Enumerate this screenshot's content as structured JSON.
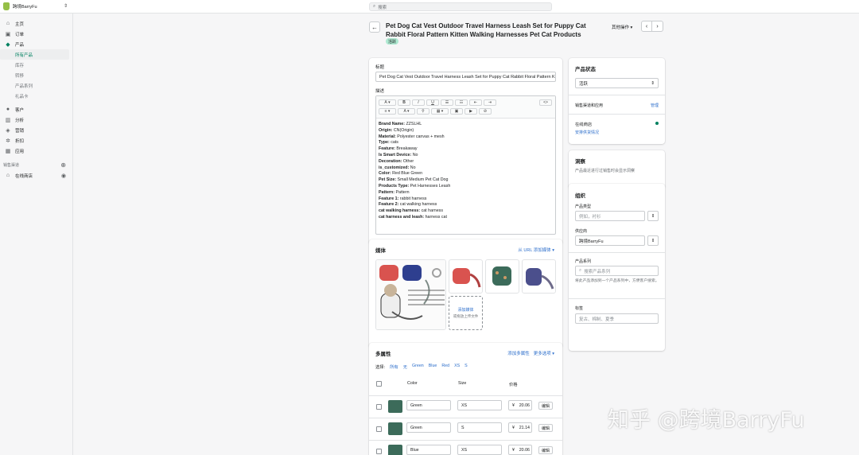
{
  "topbar": {
    "store_name": "跨境BarryFu",
    "search_placeholder": "搜索"
  },
  "sidebar": {
    "items": [
      {
        "label": "主页",
        "icon": "home-icon"
      },
      {
        "label": "订单",
        "icon": "orders-icon"
      },
      {
        "label": "产品",
        "icon": "tag-icon"
      }
    ],
    "product_subitems": [
      "所有产品",
      "库存",
      "转移",
      "产品系列",
      "礼品卡"
    ],
    "items2": [
      {
        "label": "客户",
        "icon": "customer-icon"
      },
      {
        "label": "分析",
        "icon": "analytics-icon"
      },
      {
        "label": "营销",
        "icon": "marketing-icon"
      },
      {
        "label": "折扣",
        "icon": "discount-icon"
      },
      {
        "label": "应用",
        "icon": "apps-icon"
      }
    ],
    "channels_label": "销售渠道",
    "online_store": "在线商店"
  },
  "header": {
    "title": "Pet Dog Cat Vest Outdoor Travel Harness Leash Set for Puppy Cat Rabbit Floral Pattern Kitten Walking Harnesses Pet Cat Products",
    "status_badge": "活跃",
    "more_actions": "其他操作"
  },
  "main": {
    "title_label": "标题",
    "title_value": "Pet Dog Cat Vest Outdoor Travel Harness Leash Set for Puppy Cat Rabbit Floral Pattern K",
    "desc_label": "描述",
    "toolbar": {
      "para": "A",
      "bold": "B",
      "italic": "I",
      "underline": "U",
      "code": "<>"
    },
    "description": [
      {
        "k": "Brand Name:",
        "v": " ZZSLHL"
      },
      {
        "k": "Origin:",
        "v": " CN(Origin)"
      },
      {
        "k": "Material:",
        "v": " Polyester canvas + mesh"
      },
      {
        "k": "Type:",
        "v": " cats"
      },
      {
        "k": "Feature:",
        "v": " Breakaway"
      },
      {
        "k": "Is Smart Device:",
        "v": " No"
      },
      {
        "k": "Decoration:",
        "v": " Other"
      },
      {
        "k": "is_customized:",
        "v": " No"
      },
      {
        "k": "Color:",
        "v": " Red Blue Green"
      },
      {
        "k": "Pet Size:",
        "v": " Small Medium Pet Cat Dog"
      },
      {
        "k": "Products Type:",
        "v": " Pet Harnesses Leash"
      },
      {
        "k": "Pattern:",
        "v": " Pattern"
      },
      {
        "k": "Feature 1:",
        "v": " rabbit harness"
      },
      {
        "k": "Feature 2:",
        "v": " cat walking harness"
      },
      {
        "k": "cat walking harness:",
        "v": " cat harness"
      },
      {
        "k": "cat harness and leash:",
        "v": " harness cat"
      }
    ]
  },
  "media": {
    "title": "媒体",
    "add_from_url": "从 URL 添加媒体 ▾",
    "add_media": "添加媒体",
    "drop_hint": "或拖放上传文件"
  },
  "variants": {
    "title": "多属性",
    "add_variant": "添加多属性",
    "more_options": "更多选项 ▾",
    "select_label": "选择:",
    "filters": [
      "所有",
      "无",
      "Green",
      "Blue",
      "Red",
      "XS",
      "S"
    ],
    "columns": [
      "Color",
      "Size",
      "价格"
    ],
    "rows": [
      {
        "color": "Green",
        "size": "XS",
        "price": "20.06",
        "edit": "编辑"
      },
      {
        "color": "Green",
        "size": "S",
        "price": "21.14",
        "edit": "编辑"
      },
      {
        "color": "Blue",
        "size": "XS",
        "price": "20.06",
        "edit": "编辑"
      }
    ]
  },
  "status_card": {
    "title": "产品状态",
    "value": "活跃",
    "sales_label": "销售渠道和应用",
    "manage": "管理",
    "online_store": "在线商店",
    "schedule": "安排供货情况"
  },
  "insights": {
    "title": "洞察",
    "text": "产品最近进行过销售时会显示洞察"
  },
  "organization": {
    "title": "组织",
    "type_label": "产品类型",
    "type_placeholder": "例如，衬衫",
    "vendor_label": "供应商",
    "vendor_value": "跨境BarryFu",
    "collections_label": "产品系列",
    "collections_placeholder": "搜索产品系列",
    "collections_help": "将此产品添加到一个产品系列中，方便客户搜索。",
    "tags_label": "标签",
    "tags_placeholder": "复古、棉制、夏季"
  },
  "watermark": "知乎 @跨境BarryFu"
}
